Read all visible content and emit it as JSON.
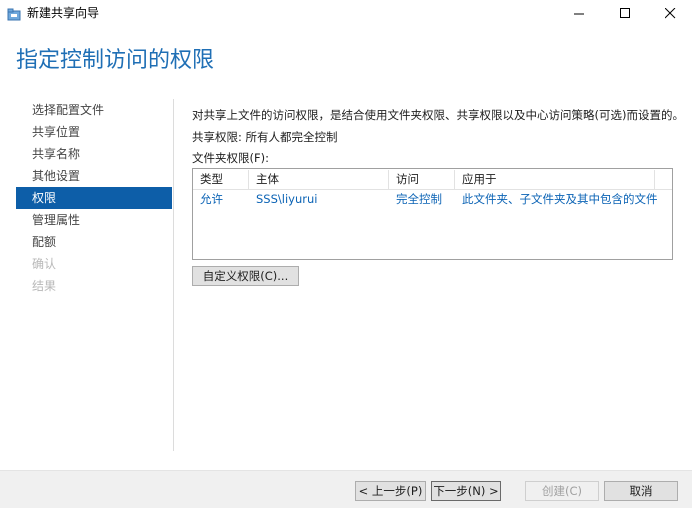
{
  "window": {
    "title": "新建共享向导",
    "icon": "share-folder-icon"
  },
  "page_title": "指定控制访问的权限",
  "nav": {
    "items": [
      {
        "label": "选择配置文件",
        "state": "normal"
      },
      {
        "label": "共享位置",
        "state": "normal"
      },
      {
        "label": "共享名称",
        "state": "normal"
      },
      {
        "label": "其他设置",
        "state": "normal"
      },
      {
        "label": "权限",
        "state": "selected"
      },
      {
        "label": "管理属性",
        "state": "normal"
      },
      {
        "label": "配额",
        "state": "normal"
      },
      {
        "label": "确认",
        "state": "disabled"
      },
      {
        "label": "结果",
        "state": "disabled"
      }
    ]
  },
  "content": {
    "description": "对共享上文件的访问权限，是结合使用文件夹权限、共享权限以及中心访问策略(可选)而设置的。",
    "share_permissions": "共享权限: 所有人都完全控制",
    "folder_permissions_label": "文件夹权限(F):",
    "table": {
      "headers": [
        "类型",
        "主体",
        "访问",
        "应用于"
      ],
      "rows": [
        [
          "允许",
          "SSS\\liyurui",
          "完全控制",
          "此文件夹、子文件夹及其中包含的文件"
        ]
      ]
    },
    "custom_button": "自定义权限(C)..."
  },
  "footer": {
    "prev": "< 上一步(P)",
    "next": "下一步(N) >",
    "create": "创建(C)",
    "cancel": "取消"
  },
  "colors": {
    "accent": "#0d5ea8",
    "title_blue": "#1f6fb5",
    "link_blue": "#0b63b5"
  }
}
